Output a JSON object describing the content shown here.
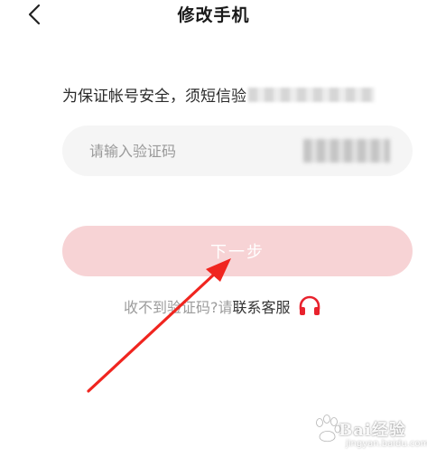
{
  "header": {
    "title": "修改手机",
    "back_icon": "chevron-left-icon"
  },
  "notice": {
    "text": "为保证帐号安全，须短信验"
  },
  "code_input": {
    "placeholder": "请输入验证码"
  },
  "next_button": {
    "label": "下一步"
  },
  "help": {
    "gray_text": "收不到验证码?请",
    "link_text": "联系客服",
    "icon": "headset-icon"
  },
  "watermark": {
    "main": "Bai经验",
    "sub": "jingyan.baidu.com"
  },
  "colors": {
    "accent": "#e8222d",
    "button_disabled": "#f7d3d5",
    "input_bg": "#f5f5f5",
    "annotation_arrow": "#f0251f"
  }
}
